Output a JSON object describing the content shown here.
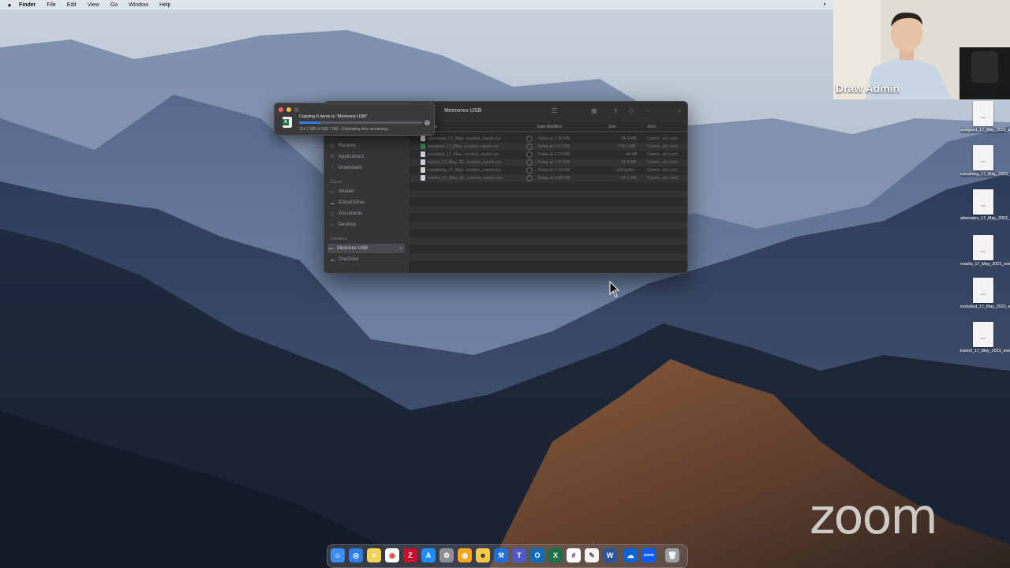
{
  "menubar": {
    "items": [
      "Finder",
      "File",
      "Edit",
      "View",
      "Go",
      "Window",
      "Help"
    ]
  },
  "finder": {
    "title": "Memorex USB",
    "sidebar": {
      "items": [
        {
          "label": "Recents",
          "icon": "clock-icon"
        },
        {
          "label": "Applications",
          "icon": "applications-icon"
        },
        {
          "label": "Downloads",
          "icon": "download-icon"
        },
        {
          "label": "Shared",
          "icon": "shared-folder-icon"
        },
        {
          "label": "iCloud Drive",
          "icon": "cloud-icon"
        },
        {
          "label": "Documents",
          "icon": "document-icon"
        },
        {
          "label": "Desktop",
          "icon": "desktop-icon"
        },
        {
          "label": "Memorex USB",
          "icon": "drive-icon"
        },
        {
          "label": "OneDrive",
          "icon": "cloud-icon"
        }
      ],
      "sections": {
        "icloud": "iCloud",
        "locations": "Locations"
      }
    },
    "columns": {
      "name": "Name",
      "date": "Date Modified",
      "size": "Size",
      "kind": "Kind"
    },
    "rows": [
      {
        "name": "alternates_17_May...ecution_report.csv",
        "date": "Today at 1:30 PM",
        "size": "34.4 MB",
        "kind": "Comm...et (.csv)"
      },
      {
        "name": "assigned_17_May...ecution_report.csv",
        "date": "Today at 1:37 PM",
        "size": "798.3 MB",
        "kind": "Comm...et (.csv)"
      },
      {
        "name": "excluded_17_May...ecution_report.csv",
        "date": "Today at 1:29 PM",
        "size": "44 KB",
        "kind": "Comm...et (.csv)"
      },
      {
        "name": "lowest_17_May_20...ecution_report.csv",
        "date": "Today at 1:27 PM",
        "size": "21.8 MB",
        "kind": "Comm...et (.csv)"
      },
      {
        "name": "remaining_17_May...ecution_report.csv",
        "date": "Today at 1:30 PM",
        "size": "523 bytes",
        "kind": "Comm...et (.csv)"
      },
      {
        "name": "results_17_May_20...ecution_report.csv",
        "date": "Today at 1:30 PM",
        "size": "84.3 MB",
        "kind": "Comm...et (.csv)"
      }
    ]
  },
  "copy_dialog": {
    "title": "Copying 6 items to “Memorex USB”",
    "status": "154.2 MB of 928.7 MB - Estimating time remaining...",
    "progress": 0.166,
    "accent": "#2f7ee8"
  },
  "zoom": {
    "participant_name": "Draw Admin",
    "watermark": "zoom"
  },
  "desktop_files": [
    "assigned_17_May_2023_e...port.csv",
    "remaining_17_May_2023_e...port.csv",
    "alternates_17_May_2023_e...port.csv",
    "results_17_May_2023_exec...port.csv",
    "excluded_17_May_2023_ex...port.csv",
    "lowest_17_May_2023_exec...port.csv"
  ],
  "dock": {
    "apps": [
      "finder-icon",
      "safari-icon",
      "notes-icon",
      "chrome-icon",
      "filezilla-icon",
      "app-store-icon",
      "settings-icon",
      "podcasts-icon",
      "sticky-icon",
      "xcode-icon",
      "teams-icon",
      "outlook-icon",
      "excel-icon",
      "slack-icon",
      "textedit-icon",
      "word-icon",
      "onedrive-icon",
      "zoom-icon",
      "trash-icon"
    ]
  }
}
